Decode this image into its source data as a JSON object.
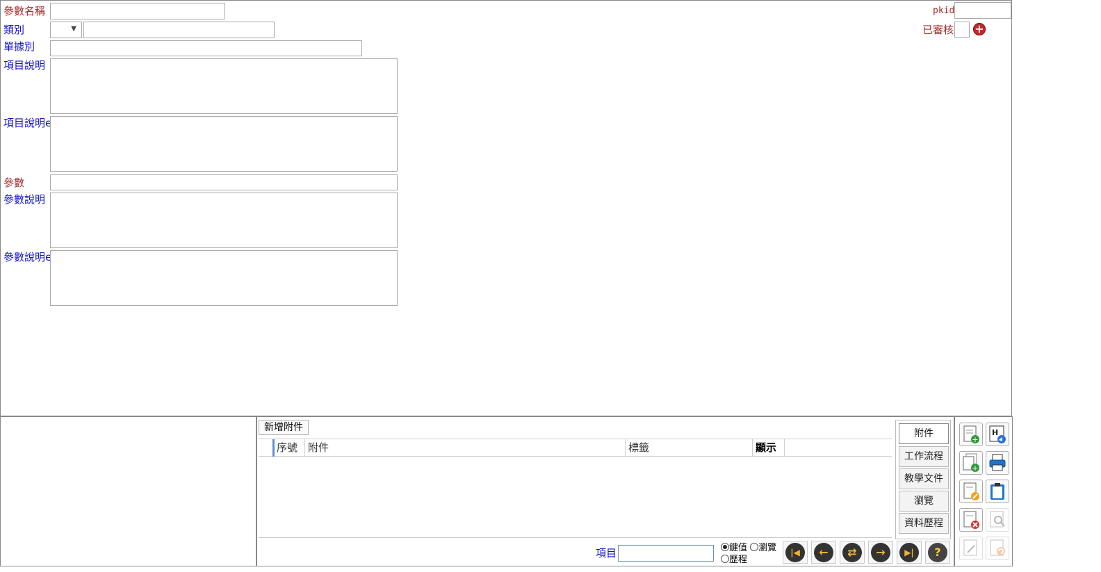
{
  "form": {
    "param_name": {
      "label": "參數名稱",
      "value": ""
    },
    "category": {
      "label": "類別",
      "select_value": "",
      "text_value": ""
    },
    "doc_type": {
      "label": "單據別",
      "value": ""
    },
    "item_desc": {
      "label": "項目說明",
      "value": ""
    },
    "item_desc_e": {
      "label": "項目說明e",
      "value": ""
    },
    "param": {
      "label": "參數",
      "value": ""
    },
    "param_desc": {
      "label": "參數說明",
      "value": ""
    },
    "param_desc_e": {
      "label": "參數說明e",
      "value": ""
    },
    "pkid": {
      "label": "pkid",
      "value": ""
    },
    "approved": {
      "label": "已審核",
      "add_symbol": "+"
    }
  },
  "attachments": {
    "add_button": "新增附件",
    "columns": [
      "序號",
      "附件",
      "標籤",
      "顯示"
    ],
    "rows": []
  },
  "side_tabs": [
    {
      "label": "附件",
      "active": true
    },
    {
      "label": "工作流程",
      "active": false
    },
    {
      "label": "教學文件",
      "active": false
    },
    {
      "label": "瀏覽",
      "active": false
    },
    {
      "label": "資料歷程",
      "active": false
    }
  ],
  "bottom_bar": {
    "item_label": "項目",
    "item_value": "",
    "mode_options": [
      {
        "label": "鍵值",
        "checked": true
      },
      {
        "label": "瀏覽",
        "checked": false
      },
      {
        "label": "歷程",
        "checked": false
      }
    ],
    "nav_buttons": [
      {
        "icon": "first-record-icon",
        "glyph": "|◀"
      },
      {
        "icon": "previous-record-icon",
        "glyph": "←"
      },
      {
        "icon": "refresh-icon",
        "glyph": "⇄"
      },
      {
        "icon": "next-record-icon",
        "glyph": "→"
      },
      {
        "icon": "last-record-icon",
        "glyph": "▶|"
      },
      {
        "icon": "help-icon",
        "glyph": "?"
      }
    ]
  },
  "toolbar": [
    {
      "icon": "new-document-icon",
      "enabled": true
    },
    {
      "icon": "html-export-icon",
      "enabled": true
    },
    {
      "icon": "copy-add-icon",
      "enabled": true
    },
    {
      "icon": "print-icon",
      "enabled": true
    },
    {
      "icon": "edit-document-icon",
      "enabled": true
    },
    {
      "icon": "clipboard-icon",
      "enabled": true
    },
    {
      "icon": "delete-document-icon",
      "enabled": true
    },
    {
      "icon": "search-preview-icon",
      "enabled": false
    },
    {
      "icon": "pencil-icon",
      "enabled": false
    },
    {
      "icon": "undo-document-icon",
      "enabled": false
    }
  ],
  "colors": {
    "red_label": "#a52a2a",
    "blue_label": "#1515c8",
    "add_icon": "#c62828"
  }
}
